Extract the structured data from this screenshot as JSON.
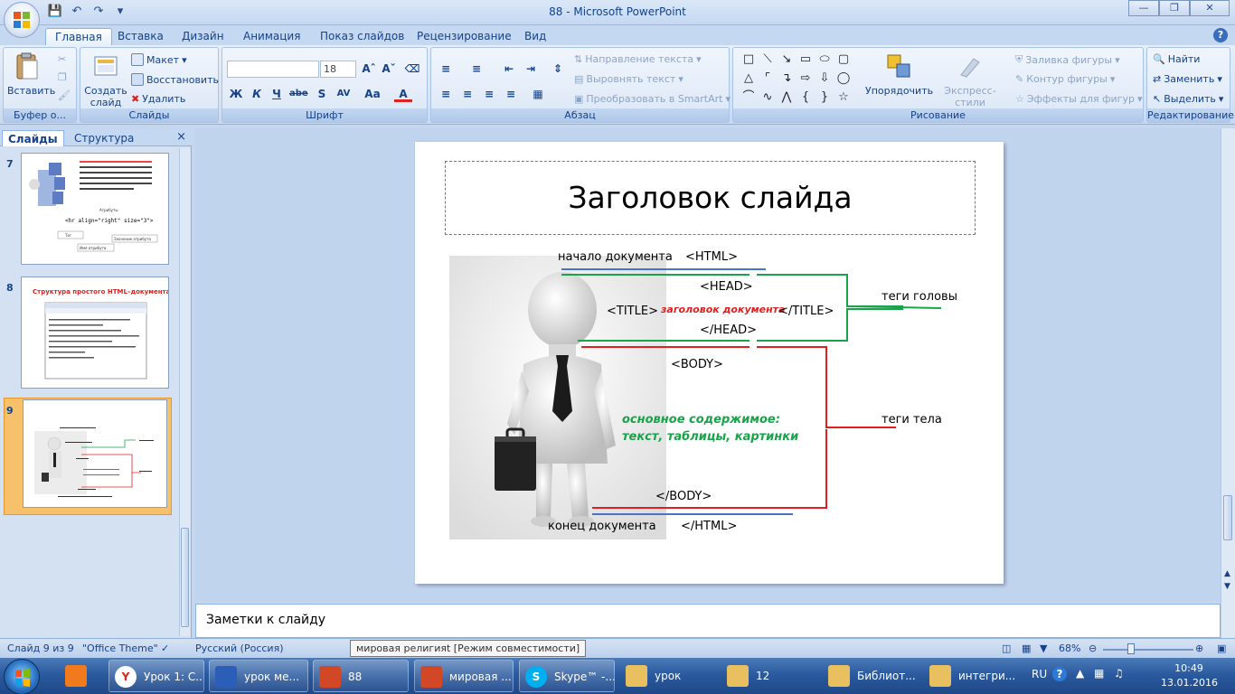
{
  "window": {
    "title": "88 - Microsoft PowerPoint"
  },
  "ribbon_tabs": [
    "Главная",
    "Вставка",
    "Дизайн",
    "Анимация",
    "Показ слайдов",
    "Рецензирование",
    "Вид"
  ],
  "ribbon": {
    "clipboard": {
      "label": "Буфер о...",
      "paste": "Вставить"
    },
    "slides": {
      "label": "Слайды",
      "new_slide": "Создать слайд",
      "layout": "Макет",
      "reset": "Восстановить",
      "delete": "Удалить"
    },
    "font": {
      "label": "Шрифт",
      "size": "18"
    },
    "paragraph": {
      "label": "Абзац",
      "text_direction": "Направление текста",
      "align_text": "Выровнять текст",
      "smartart": "Преобразовать в SmartArt"
    },
    "drawing": {
      "label": "Рисование",
      "arrange": "Упорядочить",
      "quick_styles": "Экспресс-стили",
      "shape_fill": "Заливка фигуры",
      "shape_outline": "Контур фигуры",
      "shape_effects": "Эффекты для фигур"
    },
    "editing": {
      "label": "Редактирование",
      "find": "Найти",
      "replace": "Заменить",
      "select": "Выделить"
    }
  },
  "left_pane": {
    "tabs": [
      "Слайды",
      "Структура"
    ],
    "thumbnails": [
      {
        "number": "7",
        "text": "<hr align=\"right\" size=\"3\">",
        "labels": [
          "Атрибуты",
          "Тег",
          "Имя атрибута",
          "Значение атрибута"
        ]
      },
      {
        "number": "8",
        "title": "Структура простого HTML–документа :"
      },
      {
        "number": "9"
      }
    ]
  },
  "slide": {
    "title": "Заголовок слайда",
    "doc_start": "начало документа",
    "html_open": "<HTML>",
    "head_open": "<HEAD>",
    "title_open": "<TITLE>",
    "title_text": "заголовок документа",
    "title_close": "</TITLE>",
    "head_close": "</HEAD>",
    "head_tags": "теги головы",
    "body_open": "<BODY>",
    "content_line1": "основное содержимое:",
    "content_line2": "текст, таблицы, картинки",
    "body_tags": "теги тела",
    "body_close": "</BODY>",
    "doc_end": "конец документа",
    "html_close": "</HTML>"
  },
  "notes": {
    "placeholder": "Заметки к слайду"
  },
  "status": {
    "slide_pos": "Слайд 9 из 9",
    "theme": "\"Office Theme\"",
    "language": "Русский (Россия)",
    "tooltip": "мировая религияt [Режим совместимости]",
    "zoom": "68%"
  },
  "taskbar": {
    "items": [
      "Урок 1: С...",
      "урок ме...",
      "88",
      "мировая ...",
      "Skype™ -...",
      "урок",
      "12",
      "Библиот...",
      "интегри..."
    ],
    "language": "RU",
    "time": "10:49",
    "date": "13.01.2016"
  },
  "colors": {
    "green_bracket": "#1aa34a",
    "red_bracket": "#e02020",
    "blue_line": "#4a73c4",
    "content_green": "#1aa34a",
    "title_red": "#e02020"
  }
}
